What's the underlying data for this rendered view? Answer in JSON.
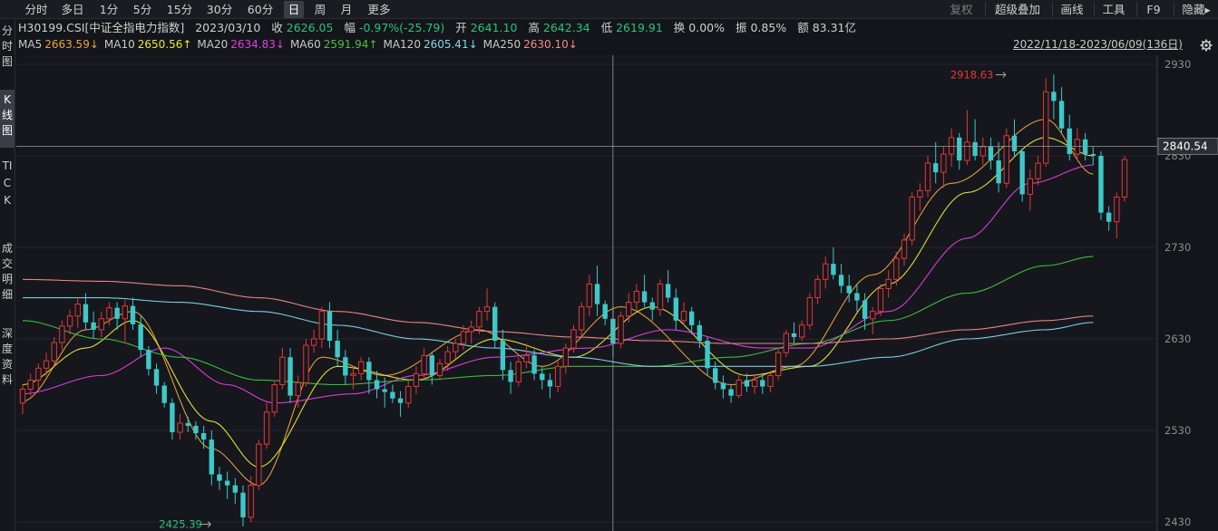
{
  "toolbar": {
    "timeframes": [
      "分时",
      "多日",
      "1分",
      "5分",
      "15分",
      "30分",
      "60分",
      "日",
      "周",
      "月",
      "更多"
    ],
    "active_timeframe": "日",
    "right_tools": [
      "复权",
      "超级叠加",
      "画线",
      "工具",
      "F9",
      "隐藏▸"
    ]
  },
  "sidebar": {
    "items": [
      "分时图",
      "K线图",
      "TICK",
      "成交明细",
      "深度资料"
    ],
    "active": "K线图"
  },
  "info": {
    "symbol": "H30199.CSI[中证全指电力指数]",
    "date": "2023/03/10",
    "close_label": "收",
    "close": "2626.05",
    "change_label": "幅",
    "change": "-0.97%(-25.79)",
    "open_label": "开",
    "open": "2641.10",
    "high_label": "高",
    "high": "2642.34",
    "low_label": "低",
    "low": "2619.91",
    "turnover_label": "换",
    "turnover": "0.00%",
    "amplitude_label": "振",
    "amplitude": "0.85%",
    "amount_label": "额",
    "amount": "83.31亿"
  },
  "ma_legend": [
    {
      "name": "MA5",
      "value": "2663.59",
      "arrow": "↓",
      "color": "#e8a33d"
    },
    {
      "name": "MA10",
      "value": "2650.56",
      "arrow": "↑",
      "color": "#e8e83a"
    },
    {
      "name": "MA20",
      "value": "2634.83",
      "arrow": "↓",
      "color": "#e040e0"
    },
    {
      "name": "MA60",
      "value": "2591.94",
      "arrow": "↑",
      "color": "#3ec43e"
    },
    {
      "name": "MA120",
      "value": "2605.41",
      "arrow": "↓",
      "color": "#7fd8e8"
    },
    {
      "name": "MA250",
      "value": "2630.10",
      "arrow": "↓",
      "color": "#f08b8b"
    }
  ],
  "date_range": "2022/11/18-2023/06/09(136日)",
  "colors": {
    "up": "#e03838",
    "down": "#3ec8c8",
    "background": "#14151a"
  },
  "chart_data": {
    "type": "candlestick",
    "ylim": [
      2430,
      2930
    ],
    "yticks": [
      2430,
      2530,
      2630,
      2730,
      2830,
      2930
    ],
    "crosshair": {
      "index": 75,
      "price": 2840.54,
      "label": "2840.54"
    },
    "annotations": [
      {
        "label": "2918.63",
        "index": 125,
        "price": 2918.63,
        "type": "high"
      },
      {
        "label": "2425.39",
        "index": 24,
        "price": 2425.39,
        "type": "low"
      }
    ],
    "ohlc": [
      [
        2560,
        2580,
        2548,
        2575
      ],
      [
        2575,
        2592,
        2568,
        2585
      ],
      [
        2585,
        2603,
        2575,
        2598
      ],
      [
        2598,
        2615,
        2590,
        2606
      ],
      [
        2606,
        2632,
        2600,
        2626
      ],
      [
        2626,
        2650,
        2618,
        2644
      ],
      [
        2644,
        2662,
        2635,
        2655
      ],
      [
        2655,
        2675,
        2642,
        2668
      ],
      [
        2668,
        2680,
        2640,
        2648
      ],
      [
        2648,
        2660,
        2630,
        2640
      ],
      [
        2640,
        2660,
        2632,
        2652
      ],
      [
        2652,
        2670,
        2645,
        2664
      ],
      [
        2664,
        2670,
        2640,
        2652
      ],
      [
        2652,
        2672,
        2625,
        2666
      ],
      [
        2666,
        2675,
        2640,
        2646
      ],
      [
        2646,
        2655,
        2610,
        2618
      ],
      [
        2618,
        2622,
        2590,
        2597
      ],
      [
        2597,
        2603,
        2570,
        2579
      ],
      [
        2579,
        2583,
        2555,
        2560
      ],
      [
        2560,
        2565,
        2520,
        2528
      ],
      [
        2528,
        2548,
        2520,
        2538
      ],
      [
        2538,
        2545,
        2528,
        2535
      ],
      [
        2535,
        2540,
        2520,
        2527
      ],
      [
        2527,
        2535,
        2510,
        2520
      ],
      [
        2520,
        2530,
        2470,
        2482
      ],
      [
        2482,
        2490,
        2465,
        2475
      ],
      [
        2475,
        2485,
        2455,
        2470
      ],
      [
        2470,
        2478,
        2450,
        2462
      ],
      [
        2462,
        2470,
        2425,
        2435
      ],
      [
        2435,
        2480,
        2430,
        2470
      ],
      [
        2470,
        2520,
        2465,
        2515
      ],
      [
        2515,
        2560,
        2510,
        2550
      ],
      [
        2550,
        2585,
        2545,
        2580
      ],
      [
        2580,
        2620,
        2575,
        2610
      ],
      [
        2610,
        2620,
        2560,
        2568
      ],
      [
        2568,
        2590,
        2555,
        2582
      ],
      [
        2582,
        2630,
        2578,
        2623
      ],
      [
        2623,
        2640,
        2615,
        2630
      ],
      [
        2630,
        2665,
        2620,
        2660
      ],
      [
        2660,
        2670,
        2620,
        2628
      ],
      [
        2628,
        2640,
        2600,
        2610
      ],
      [
        2610,
        2618,
        2580,
        2590
      ],
      [
        2590,
        2600,
        2575,
        2592
      ],
      [
        2592,
        2610,
        2585,
        2605
      ],
      [
        2605,
        2610,
        2570,
        2585
      ],
      [
        2585,
        2595,
        2565,
        2575
      ],
      [
        2575,
        2588,
        2555,
        2572
      ],
      [
        2572,
        2580,
        2560,
        2565
      ],
      [
        2565,
        2573,
        2545,
        2560
      ],
      [
        2560,
        2585,
        2555,
        2578
      ],
      [
        2578,
        2600,
        2570,
        2592
      ],
      [
        2592,
        2620,
        2585,
        2612
      ],
      [
        2612,
        2615,
        2580,
        2590
      ],
      [
        2590,
        2608,
        2585,
        2603
      ],
      [
        2603,
        2622,
        2595,
        2616
      ],
      [
        2616,
        2630,
        2608,
        2625
      ],
      [
        2625,
        2645,
        2618,
        2638
      ],
      [
        2638,
        2650,
        2625,
        2643
      ],
      [
        2643,
        2665,
        2635,
        2660
      ],
      [
        2660,
        2685,
        2650,
        2665
      ],
      [
        2665,
        2670,
        2620,
        2628
      ],
      [
        2628,
        2640,
        2585,
        2596
      ],
      [
        2596,
        2605,
        2570,
        2583
      ],
      [
        2583,
        2610,
        2578,
        2605
      ],
      [
        2605,
        2625,
        2598,
        2612
      ],
      [
        2612,
        2618,
        2585,
        2592
      ],
      [
        2592,
        2600,
        2575,
        2585
      ],
      [
        2585,
        2592,
        2565,
        2578
      ],
      [
        2578,
        2605,
        2572,
        2600
      ],
      [
        2600,
        2625,
        2592,
        2620
      ],
      [
        2620,
        2645,
        2615,
        2640
      ],
      [
        2640,
        2670,
        2632,
        2665
      ],
      [
        2665,
        2700,
        2655,
        2690
      ],
      [
        2690,
        2710,
        2655,
        2668
      ],
      [
        2668,
        2672,
        2645,
        2652
      ],
      [
        2652,
        2665,
        2610,
        2625
      ],
      [
        2625,
        2660,
        2620,
        2655
      ],
      [
        2655,
        2680,
        2648,
        2670
      ],
      [
        2670,
        2690,
        2660,
        2682
      ],
      [
        2682,
        2700,
        2665,
        2670
      ],
      [
        2670,
        2675,
        2650,
        2662
      ],
      [
        2662,
        2695,
        2655,
        2690
      ],
      [
        2690,
        2705,
        2670,
        2675
      ],
      [
        2675,
        2685,
        2640,
        2650
      ],
      [
        2650,
        2670,
        2645,
        2660
      ],
      [
        2660,
        2665,
        2635,
        2645
      ],
      [
        2645,
        2650,
        2620,
        2628
      ],
      [
        2628,
        2632,
        2590,
        2598
      ],
      [
        2598,
        2605,
        2575,
        2582
      ],
      [
        2582,
        2590,
        2565,
        2575
      ],
      [
        2575,
        2580,
        2560,
        2568
      ],
      [
        2568,
        2590,
        2565,
        2585
      ],
      [
        2585,
        2592,
        2572,
        2578
      ],
      [
        2578,
        2590,
        2570,
        2585
      ],
      [
        2585,
        2590,
        2570,
        2578
      ],
      [
        2578,
        2595,
        2572,
        2590
      ],
      [
        2590,
        2620,
        2585,
        2615
      ],
      [
        2615,
        2640,
        2610,
        2636
      ],
      [
        2636,
        2648,
        2625,
        2632
      ],
      [
        2632,
        2650,
        2628,
        2645
      ],
      [
        2645,
        2680,
        2640,
        2675
      ],
      [
        2675,
        2700,
        2668,
        2695
      ],
      [
        2695,
        2720,
        2685,
        2712
      ],
      [
        2712,
        2730,
        2695,
        2700
      ],
      [
        2700,
        2712,
        2680,
        2688
      ],
      [
        2688,
        2700,
        2670,
        2680
      ],
      [
        2680,
        2690,
        2660,
        2672
      ],
      [
        2672,
        2680,
        2640,
        2652
      ],
      [
        2652,
        2665,
        2635,
        2660
      ],
      [
        2660,
        2690,
        2655,
        2685
      ],
      [
        2685,
        2705,
        2675,
        2695
      ],
      [
        2695,
        2725,
        2688,
        2718
      ],
      [
        2718,
        2745,
        2710,
        2738
      ],
      [
        2738,
        2790,
        2732,
        2785
      ],
      [
        2785,
        2800,
        2770,
        2792
      ],
      [
        2792,
        2830,
        2785,
        2822
      ],
      [
        2822,
        2845,
        2800,
        2812
      ],
      [
        2812,
        2840,
        2795,
        2832
      ],
      [
        2832,
        2860,
        2818,
        2850
      ],
      [
        2850,
        2855,
        2815,
        2825
      ],
      [
        2825,
        2880,
        2820,
        2845
      ],
      [
        2845,
        2870,
        2825,
        2830
      ],
      [
        2830,
        2850,
        2820,
        2840
      ],
      [
        2840,
        2850,
        2815,
        2825
      ],
      [
        2825,
        2845,
        2790,
        2800
      ],
      [
        2800,
        2860,
        2795,
        2852
      ],
      [
        2852,
        2870,
        2830,
        2835
      ],
      [
        2835,
        2838,
        2780,
        2788
      ],
      [
        2788,
        2815,
        2770,
        2805
      ],
      [
        2805,
        2830,
        2798,
        2822
      ],
      [
        2822,
        2915,
        2818,
        2900
      ],
      [
        2900,
        2919,
        2870,
        2890
      ],
      [
        2890,
        2905,
        2855,
        2860
      ],
      [
        2860,
        2875,
        2825,
        2832
      ],
      [
        2832,
        2860,
        2825,
        2848
      ],
      [
        2848,
        2855,
        2825,
        2832
      ],
      [
        2832,
        2840,
        2820,
        2830
      ],
      [
        2830,
        2835,
        2760,
        2768
      ],
      [
        2768,
        2775,
        2748,
        2758
      ],
      [
        2758,
        2790,
        2740,
        2785
      ],
      [
        2785,
        2830,
        2780,
        2826
      ]
    ],
    "ma": [
      {
        "name": "MA5",
        "color": "#e8a33d",
        "start": 2562,
        "pts": [
          [
            0,
            2562
          ],
          [
            8,
            2640
          ],
          [
            14,
            2660
          ],
          [
            24,
            2510
          ],
          [
            30,
            2470
          ],
          [
            38,
            2610
          ],
          [
            46,
            2590
          ],
          [
            58,
            2640
          ],
          [
            66,
            2600
          ],
          [
            76,
            2665
          ],
          [
            90,
            2580
          ],
          [
            98,
            2600
          ],
          [
            108,
            2700
          ],
          [
            118,
            2800
          ],
          [
            130,
            2870
          ],
          [
            136,
            2810
          ]
        ]
      },
      {
        "name": "MA10",
        "color": "#e8e83a",
        "pts": [
          [
            0,
            2580
          ],
          [
            8,
            2620
          ],
          [
            14,
            2650
          ],
          [
            24,
            2540
          ],
          [
            30,
            2490
          ],
          [
            40,
            2600
          ],
          [
            50,
            2585
          ],
          [
            60,
            2630
          ],
          [
            70,
            2610
          ],
          [
            80,
            2665
          ],
          [
            92,
            2590
          ],
          [
            100,
            2600
          ],
          [
            110,
            2690
          ],
          [
            120,
            2790
          ],
          [
            130,
            2850
          ],
          [
            136,
            2830
          ]
        ]
      },
      {
        "name": "MA20",
        "color": "#e040e0",
        "pts": [
          [
            0,
            2570
          ],
          [
            10,
            2590
          ],
          [
            18,
            2620
          ],
          [
            26,
            2580
          ],
          [
            32,
            2560
          ],
          [
            42,
            2570
          ],
          [
            50,
            2590
          ],
          [
            60,
            2610
          ],
          [
            72,
            2620
          ],
          [
            82,
            2640
          ],
          [
            94,
            2620
          ],
          [
            100,
            2620
          ],
          [
            110,
            2660
          ],
          [
            120,
            2740
          ],
          [
            128,
            2800
          ],
          [
            136,
            2820
          ]
        ]
      },
      {
        "name": "MA60",
        "color": "#3ec43e",
        "pts": [
          [
            0,
            2650
          ],
          [
            10,
            2630
          ],
          [
            20,
            2610
          ],
          [
            30,
            2585
          ],
          [
            40,
            2580
          ],
          [
            50,
            2585
          ],
          [
            60,
            2590
          ],
          [
            70,
            2600
          ],
          [
            80,
            2600
          ],
          [
            90,
            2610
          ],
          [
            100,
            2625
          ],
          [
            110,
            2650
          ],
          [
            120,
            2680
          ],
          [
            130,
            2710
          ],
          [
            136,
            2720
          ]
        ]
      },
      {
        "name": "MA120",
        "color": "#7fd8e8",
        "pts": [
          [
            0,
            2675
          ],
          [
            10,
            2675
          ],
          [
            20,
            2670
          ],
          [
            30,
            2660
          ],
          [
            40,
            2645
          ],
          [
            50,
            2630
          ],
          [
            60,
            2620
          ],
          [
            70,
            2610
          ],
          [
            80,
            2600
          ],
          [
            90,
            2600
          ],
          [
            100,
            2600
          ],
          [
            110,
            2610
          ],
          [
            120,
            2630
          ],
          [
            130,
            2640
          ],
          [
            136,
            2648
          ]
        ]
      },
      {
        "name": "MA250",
        "color": "#f08b8b",
        "pts": [
          [
            0,
            2695
          ],
          [
            10,
            2693
          ],
          [
            20,
            2688
          ],
          [
            30,
            2675
          ],
          [
            40,
            2660
          ],
          [
            50,
            2648
          ],
          [
            60,
            2638
          ],
          [
            70,
            2632
          ],
          [
            80,
            2628
          ],
          [
            90,
            2625
          ],
          [
            100,
            2625
          ],
          [
            110,
            2630
          ],
          [
            120,
            2640
          ],
          [
            130,
            2650
          ],
          [
            136,
            2655
          ]
        ]
      }
    ]
  }
}
